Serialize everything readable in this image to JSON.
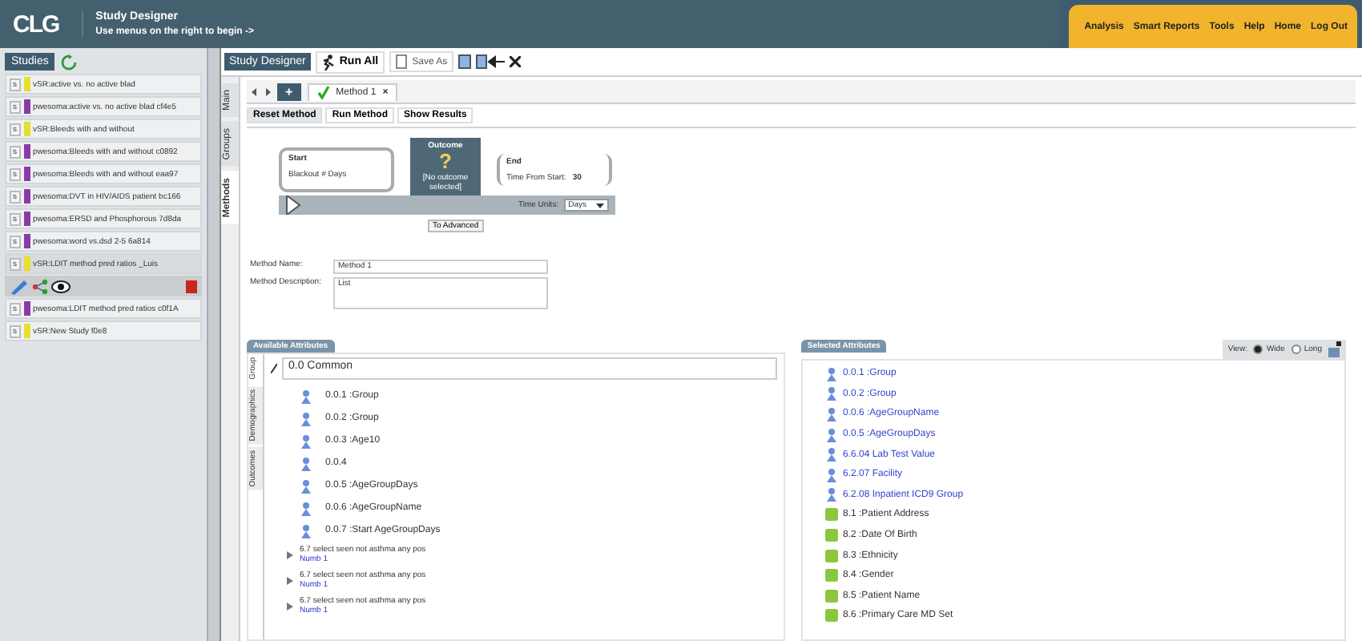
{
  "header": {
    "logo": "CLG",
    "title": "Study Designer",
    "subtitle": "Use menus on the right to begin ->"
  },
  "menu": [
    "Analysis",
    "Smart Reports",
    "Tools",
    "Help",
    "Home",
    "Log Out"
  ],
  "studies": {
    "tab": "Studies",
    "items": [
      {
        "badge": "s",
        "color": "#e6df2e",
        "label": "vSR:active vs. no active blad",
        "selected": false
      },
      {
        "badge": "s",
        "color": "#8a3aa8",
        "label": "pwesoma:active vs. no active blad cf4e5",
        "selected": false
      },
      {
        "badge": "s",
        "color": "#e6df2e",
        "label": "vSR:Bleeds with and without",
        "selected": false
      },
      {
        "badge": "s",
        "color": "#8a3aa8",
        "label": "pwesoma:Bleeds with and without c0892",
        "selected": false
      },
      {
        "badge": "s",
        "color": "#8a3aa8",
        "label": "pwesoma:Bleeds with and without eaa97",
        "selected": false
      },
      {
        "badge": "s",
        "color": "#8a3aa8",
        "label": "pwesoma:DVT in HIV/AIDS patient bc166",
        "selected": false
      },
      {
        "badge": "s",
        "color": "#8a3aa8",
        "label": "pwesoma:ERSD and Phosphorous 7d8da",
        "selected": false
      },
      {
        "badge": "s",
        "color": "#8a3aa8",
        "label": "pwesoma:word vs.dsd 2-5 6a814",
        "selected": false
      },
      {
        "badge": "s",
        "color": "#e6df2e",
        "label": "vSR:LDIT method pred ratios _Luis",
        "selected": true
      },
      {
        "badge": "s",
        "color": "#8a3aa8",
        "label": "pwesoma:LDIT method pred ratios c0f1A",
        "selected": false
      },
      {
        "badge": "s",
        "color": "#e6df2e",
        "label": "vSR:New Study f0e8",
        "selected": false
      }
    ]
  },
  "toolbar": {
    "title": "Study Designer",
    "run_all": "Run All",
    "save_as": "Save As"
  },
  "side_tabs": [
    {
      "label": "Main",
      "selected": false
    },
    {
      "label": "Groups",
      "selected": false
    },
    {
      "label": "Methods",
      "selected": true
    }
  ],
  "method_tabs": {
    "add": "+",
    "tabs": [
      {
        "label": "Method 1",
        "selected": true,
        "close": "×"
      }
    ]
  },
  "actions": [
    {
      "label": "Reset Method",
      "selected": true
    },
    {
      "label": "Run Method",
      "selected": false
    },
    {
      "label": "Show Results",
      "selected": false
    }
  ],
  "diagram": {
    "start": {
      "title": "Start",
      "detail": "Blackout # Days"
    },
    "outcome": {
      "title": "Outcome",
      "mark": "?",
      "detail": "[No outcome selected]"
    },
    "end": {
      "title": "End",
      "detail": "Time From Start:",
      "value": "30"
    },
    "time_units": {
      "label": "Time Units:",
      "value": "Days"
    },
    "advanced": "To Advanced"
  },
  "form": [
    {
      "kind": "line",
      "label": "Method Name:",
      "value": "Method 1"
    },
    {
      "kind": "area",
      "label": "Method Description:",
      "value": "List"
    }
  ],
  "available": {
    "title": "Available Attributes",
    "tabs": [
      {
        "label": "Group",
        "selected": true
      },
      {
        "label": "Demographics",
        "selected": false
      },
      {
        "label": "Outcomes",
        "selected": false
      }
    ],
    "group": "0.0 Common",
    "items": [
      {
        "code": "0.0.1",
        "name": ":Group"
      },
      {
        "code": "0.0.2",
        "name": ":Group"
      },
      {
        "code": "0.0.3",
        "name": ":Age10"
      },
      {
        "code": "0.0.4"
      },
      {
        "code": "0.0.5",
        "name": ":AgeGroupDays"
      },
      {
        "code": "0.0.6",
        "name": ":AgeGroupName"
      },
      {
        "code": "0.0.7",
        "name": ":Start AgeGroupDays"
      }
    ],
    "rows": [
      {
        "text": "6.7 select seen not asthma any pos",
        "link": "Numb 1"
      },
      {
        "text": "6.7 select seen not asthma any pos",
        "link": "Numb 1"
      },
      {
        "text": "6.7 select seen not asthma any pos",
        "link": "Numb 1"
      }
    ]
  },
  "selected": {
    "title": "Selected Attributes",
    "view_label": "View:",
    "views": [
      {
        "label": "Wide",
        "selected": true
      },
      {
        "label": "Long",
        "selected": false
      }
    ],
    "items": [
      {
        "kind": "person",
        "code": "0.0.1",
        "name": ":Group"
      },
      {
        "kind": "person",
        "code": "0.0.2",
        "name": ":Group"
      },
      {
        "kind": "person",
        "code": "0.0.6",
        "name": ":AgeGroupName"
      },
      {
        "kind": "person",
        "code": "0.0.5",
        "name": ":AgeGroupDays"
      },
      {
        "kind": "person",
        "code": "6.6.04",
        "name": "Lab Test Value"
      },
      {
        "kind": "person",
        "code": "6.2.07",
        "name": "Facility"
      },
      {
        "kind": "person",
        "code": "6.2.08",
        "name": "Inpatient ICD9 Group"
      },
      {
        "kind": "column",
        "code": "8.1",
        "name": ":Patient Address"
      },
      {
        "kind": "column",
        "code": "8.2",
        "name": ":Date Of Birth"
      },
      {
        "kind": "column",
        "code": "8.3",
        "name": ":Ethnicity"
      },
      {
        "kind": "column",
        "code": "8.4",
        "name": ":Gender"
      },
      {
        "kind": "column",
        "code": "8.5",
        "name": ":Patient Name"
      },
      {
        "kind": "column",
        "code": "8.6",
        "name": ":Primary Care MD Set"
      }
    ]
  }
}
